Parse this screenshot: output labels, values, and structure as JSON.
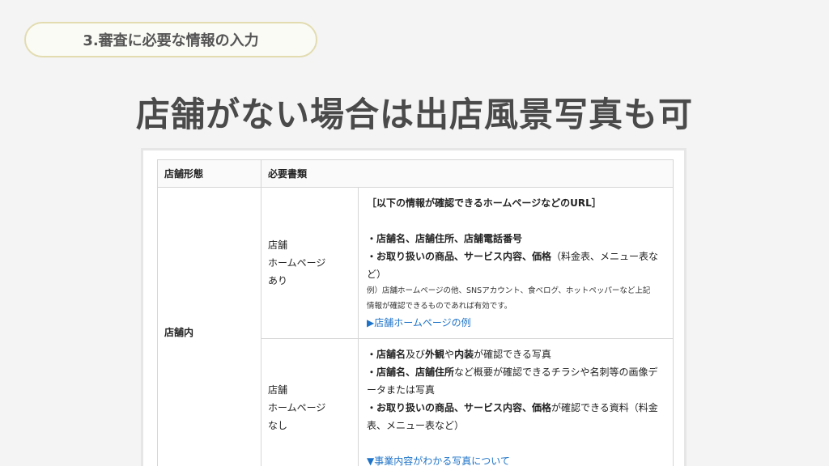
{
  "pill": {
    "label": "3.審査に必要な情報の入力"
  },
  "headline": "店舗がない場合は出店風景写真も可",
  "table": {
    "headers": [
      "店舗形態",
      "必要書類"
    ],
    "store_type": "店舗内",
    "rows": [
      {
        "condition": [
          "店舗",
          "ホームページ",
          "あり"
        ],
        "heading": "［以下の情報が確認できるホームページなどのURL］",
        "line1": "・店舗名、店舗住所、店舗電話番号",
        "line2_bold": "・お取り扱いの商品、サービス内容、価格",
        "line2_rest": "（料金表、メニュー表など）",
        "note1": "例）店舗ホームページの他、SNSアカウント、食べログ、ホットペッパーなど上記",
        "note2": "情報が確認できるものであれば有効です。",
        "link": "▶店舗ホームページの例"
      },
      {
        "condition": [
          "店舗",
          "ホームページ",
          "なし"
        ],
        "l1_a": "・店舗名",
        "l1_b": "及び",
        "l1_c": "外観",
        "l1_d": "や",
        "l1_e": "内装",
        "l1_f": "が確認できる写真",
        "l2_a": "・店舗名、店舗住所",
        "l2_b": "など概要が確認できるチラシや名刺等の画像データまたは写真",
        "l3_a": "・お取り扱いの商品、サービス内容、価格",
        "l3_b": "が確認できる資料（料金表、メニュー表など）",
        "link": "▼事業内容がわかる写真について"
      }
    ]
  }
}
